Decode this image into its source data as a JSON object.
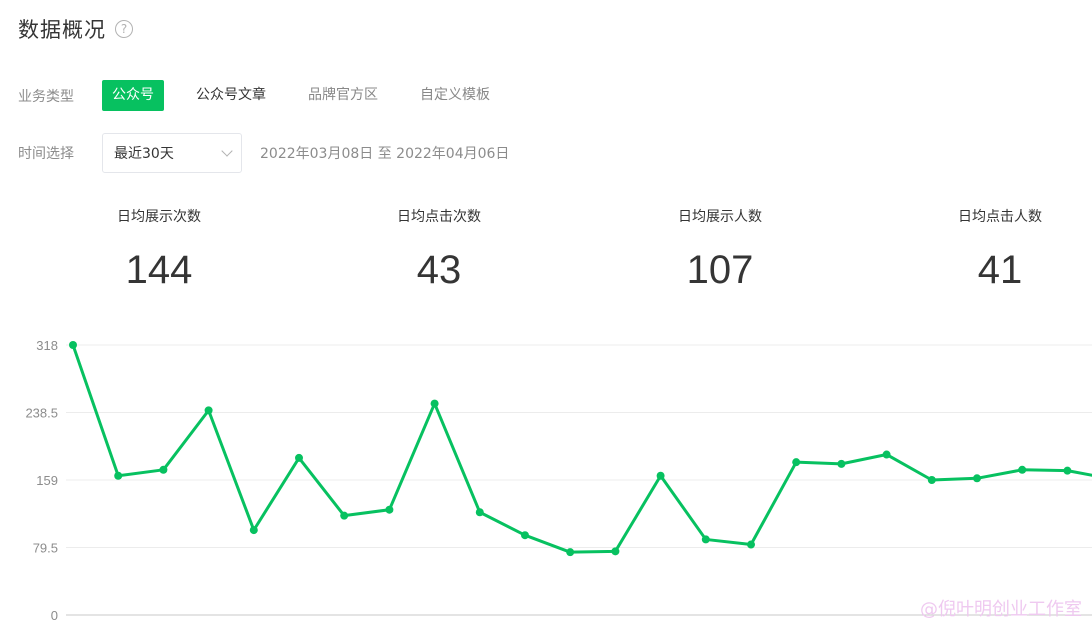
{
  "header": {
    "title": "数据概况",
    "help_icon": "?"
  },
  "filters": {
    "type_label": "业务类型",
    "type_tabs": [
      {
        "label": "公众号",
        "active": true
      },
      {
        "label": "公众号文章",
        "active": false
      },
      {
        "label": "品牌官方区",
        "active": false
      },
      {
        "label": "自定义模板",
        "active": false
      }
    ],
    "time_label": "时间选择",
    "time_select_value": "最近30天",
    "date_range": "2022年03月08日 至 2022年04月06日"
  },
  "stats": [
    {
      "label": "日均展示次数",
      "value": "144"
    },
    {
      "label": "日均点击次数",
      "value": "43"
    },
    {
      "label": "日均展示人数",
      "value": "107"
    },
    {
      "label": "日均点击人数",
      "value": "41"
    }
  ],
  "chart_data": {
    "type": "line",
    "y_ticks": [
      "318",
      "238.5",
      "159",
      "79.5",
      "0"
    ],
    "ylim": [
      0,
      318
    ],
    "grid": true,
    "series_color": "#07c160",
    "values": [
      318,
      164,
      171,
      241,
      100,
      185,
      117,
      124,
      249,
      121,
      94,
      74,
      75,
      164,
      89,
      83,
      180,
      178,
      189,
      159,
      161,
      171,
      170,
      160
    ]
  },
  "watermark": "@倪叶明创业工作室"
}
